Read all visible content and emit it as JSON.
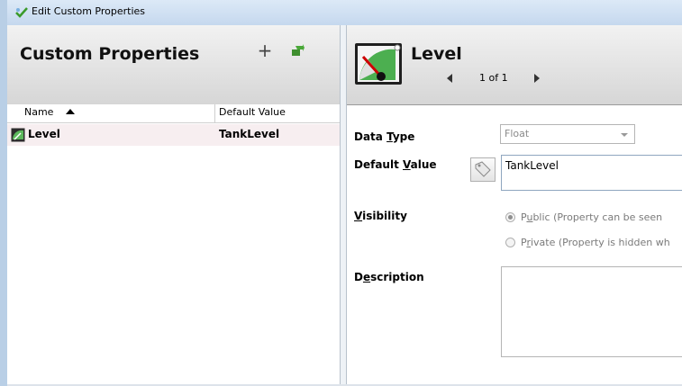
{
  "window": {
    "title": "Edit Custom Properties"
  },
  "left_pane": {
    "title": "Custom Properties",
    "add_label": "+",
    "columns": {
      "name": "Name",
      "default_value": "Default Value"
    },
    "rows": [
      {
        "name": "Level",
        "default_value": "TankLevel"
      }
    ]
  },
  "right_pane": {
    "title": "Level",
    "pager": "1 of 1"
  },
  "form": {
    "data_type": {
      "label_pre": "Data ",
      "label_key": "T",
      "label_post": "ype",
      "value": "Float"
    },
    "default_value": {
      "label_pre": "Default ",
      "label_key": "V",
      "label_post": "alue",
      "value": "TankLevel"
    },
    "visibility": {
      "label_pre": "",
      "label_key": "V",
      "label_post": "isibility",
      "public": {
        "pre": "P",
        "key": "u",
        "post": "blic (Property can be seen"
      },
      "private": {
        "pre": "P",
        "key": "r",
        "post": "ivate (Property is hidden wh"
      },
      "selected": "public"
    },
    "description": {
      "label_pre": "D",
      "label_key": "e",
      "label_post": "scription",
      "value": ""
    }
  },
  "colors": {
    "frame": "#b9cfe6",
    "selected_row": "#f7eef0",
    "gauge_green": "#4caf50"
  }
}
